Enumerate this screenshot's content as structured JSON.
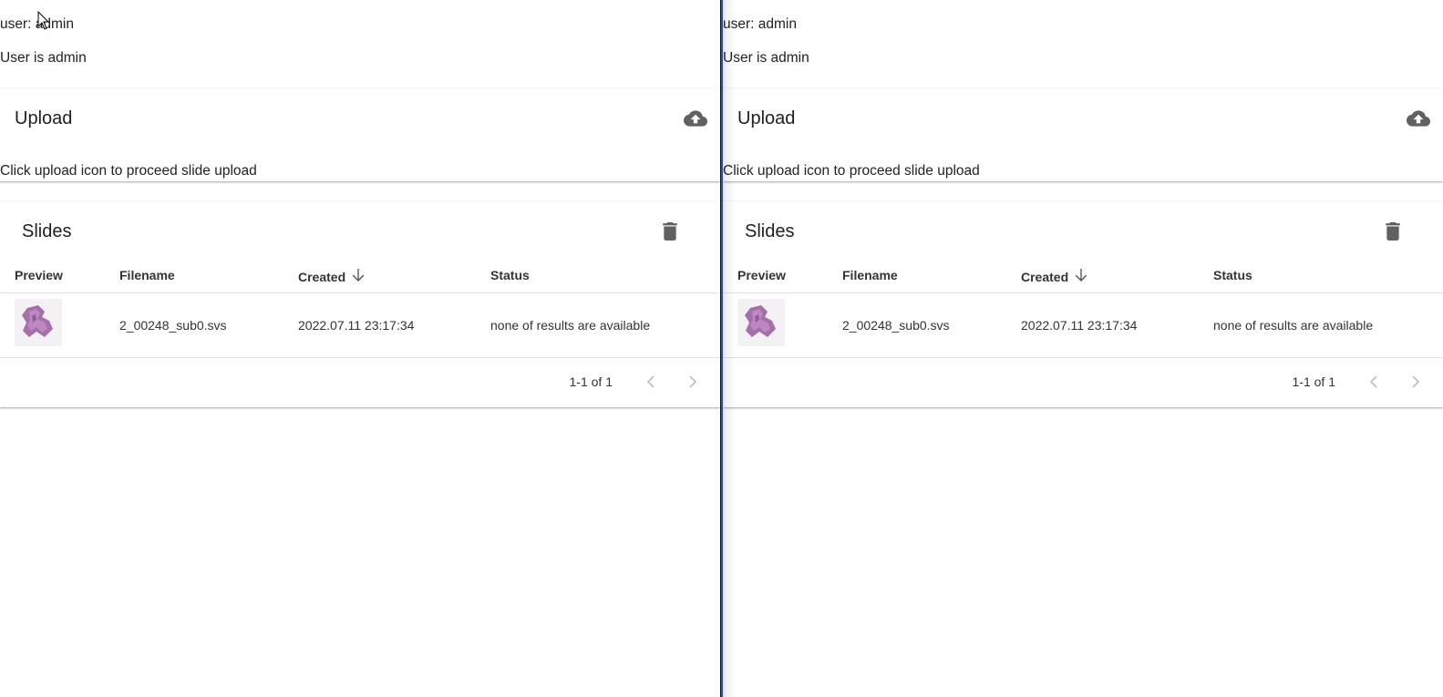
{
  "panes": [
    {
      "user_line": "user: admin",
      "role_line": "User is admin",
      "upload": {
        "title": "Upload",
        "hint": "Click upload icon to proceed slide upload"
      },
      "slides": {
        "title": "Slides",
        "columns": {
          "preview": "Preview",
          "filename": "Filename",
          "created": "Created",
          "status": "Status"
        },
        "rows": [
          {
            "filename": "2_00248_sub0.svs",
            "created": "2022.07.11 23:17:34",
            "status": "none of results are available"
          }
        ],
        "pagination": "1-1 of 1"
      }
    },
    {
      "user_line": "user: admin",
      "role_line": "User is admin",
      "upload": {
        "title": "Upload",
        "hint": "Click upload icon to proceed slide upload"
      },
      "slides": {
        "title": "Slides",
        "columns": {
          "preview": "Preview",
          "filename": "Filename",
          "created": "Created",
          "status": "Status"
        },
        "rows": [
          {
            "filename": "2_00248_sub0.svs",
            "created": "2022.07.11 23:17:34",
            "status": "none of results are available"
          }
        ],
        "pagination": "1-1 of 1"
      }
    }
  ],
  "icons": {
    "upload": "cloud-upload-icon",
    "delete": "trash-icon",
    "sort": "arrow-down-icon",
    "prev": "chevron-left-icon",
    "next": "chevron-right-icon"
  },
  "colors": {
    "divider_accent": "#2a4fbf",
    "icon": "#616161",
    "pager_disabled": "#bdbdbd"
  }
}
